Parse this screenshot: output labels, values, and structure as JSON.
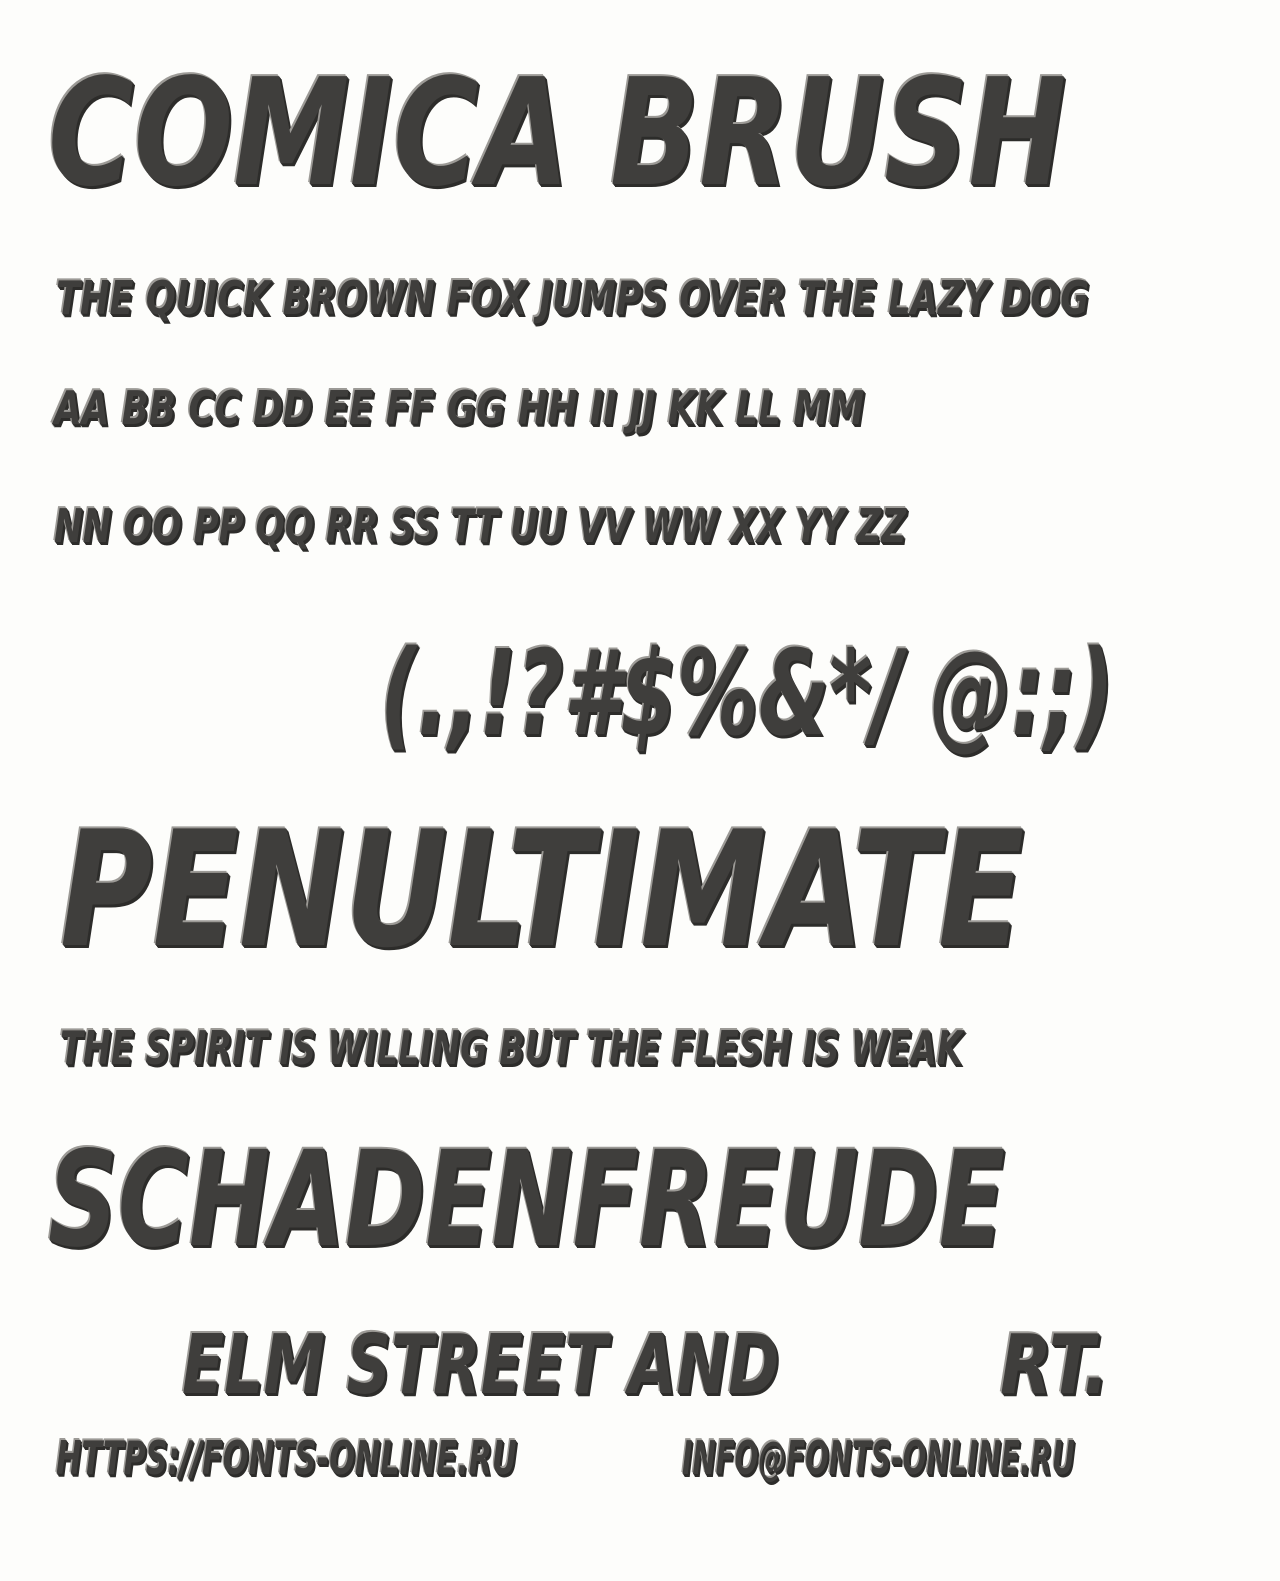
{
  "specimen": {
    "title": "Comica Brush",
    "pangram": "The quick brown fox jumps over the lazy dog",
    "alphabet_line_1": "Aa Bb Cc Dd Ee Ff Gg Hh Ii Jj Kk Ll Mm",
    "alphabet_line_2": "Nn Oo Pp Qq Rr Ss Tt Uu Vv Ww Xx Yy Zz",
    "symbols": "(.,!?#$%&*/ @:;)",
    "word_1": "Penultimate",
    "phrase": "The spirit is willing but the flesh is weak",
    "word_2": "Schadenfreude",
    "street_part_1": "Elm Street and",
    "street_part_2": "Rt.",
    "website": "https://fonts-online.ru",
    "email": "info@fonts-online.ru"
  },
  "colors": {
    "background": "#fdfdfb",
    "ink": "#3f3e3c",
    "highlight": "#9c9a96",
    "shadow": "#2d2c2a"
  }
}
